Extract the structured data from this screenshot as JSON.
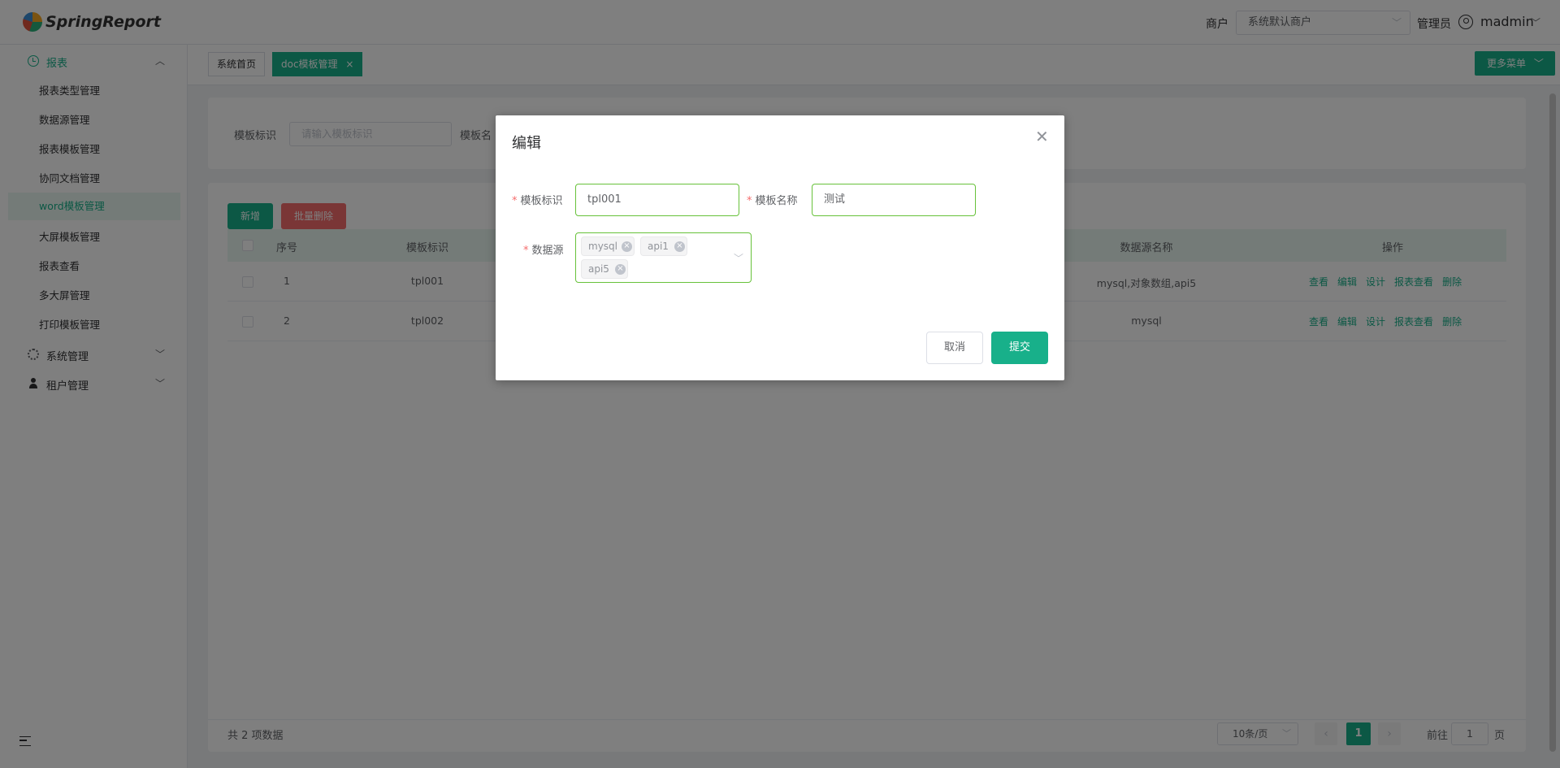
{
  "header": {
    "logo_text": "SpringReport",
    "tenant_label": "商户",
    "tenant_value": "系统默认商户",
    "role_label": "管理员",
    "user_name": "madmin"
  },
  "sidebar": {
    "group_report": "报表",
    "items": [
      {
        "label": "报表类型管理"
      },
      {
        "label": "数据源管理"
      },
      {
        "label": "报表模板管理"
      },
      {
        "label": "协同文档管理"
      },
      {
        "label": "word模板管理"
      },
      {
        "label": "大屏模板管理"
      },
      {
        "label": "报表查看"
      },
      {
        "label": "多大屏管理"
      },
      {
        "label": "打印模板管理"
      }
    ],
    "group_system": "系统管理",
    "group_tenant": "租户管理"
  },
  "tabs": {
    "home": "系统首页",
    "current": "doc模板管理",
    "close": "×",
    "more_menu": "更多菜单"
  },
  "search": {
    "label_code": "模板标识",
    "placeholder_code": "请输入模板标识",
    "label_name": "模板名"
  },
  "table": {
    "add_button": "新增",
    "batch_delete_button": "批量删除",
    "columns": {
      "index": "序号",
      "code": "模板标识",
      "datasource": "数据源名称",
      "ops": "操作"
    },
    "rows": [
      {
        "index": "1",
        "code": "tpl001",
        "datasource": "mysql,对象数组,api5"
      },
      {
        "index": "2",
        "code": "tpl002",
        "datasource": "mysql"
      }
    ],
    "actions": {
      "view": "查看",
      "edit": "编辑",
      "design": "设计",
      "report_view": "报表查看",
      "delete": "删除"
    },
    "total": "共 2 项数据",
    "page_size": "10条/页",
    "current_page": "1",
    "goto_label": "前往",
    "goto_value": "1",
    "goto_unit": "页"
  },
  "dialog": {
    "title": "编辑",
    "required_mark": "*",
    "label_code": "模板标识",
    "value_code": "tpl001",
    "label_name": "模板名称",
    "value_name": "测试",
    "label_datasource": "数据源",
    "datasources": [
      "mysql",
      "api1",
      "api5"
    ],
    "cancel": "取消",
    "submit": "提交"
  }
}
